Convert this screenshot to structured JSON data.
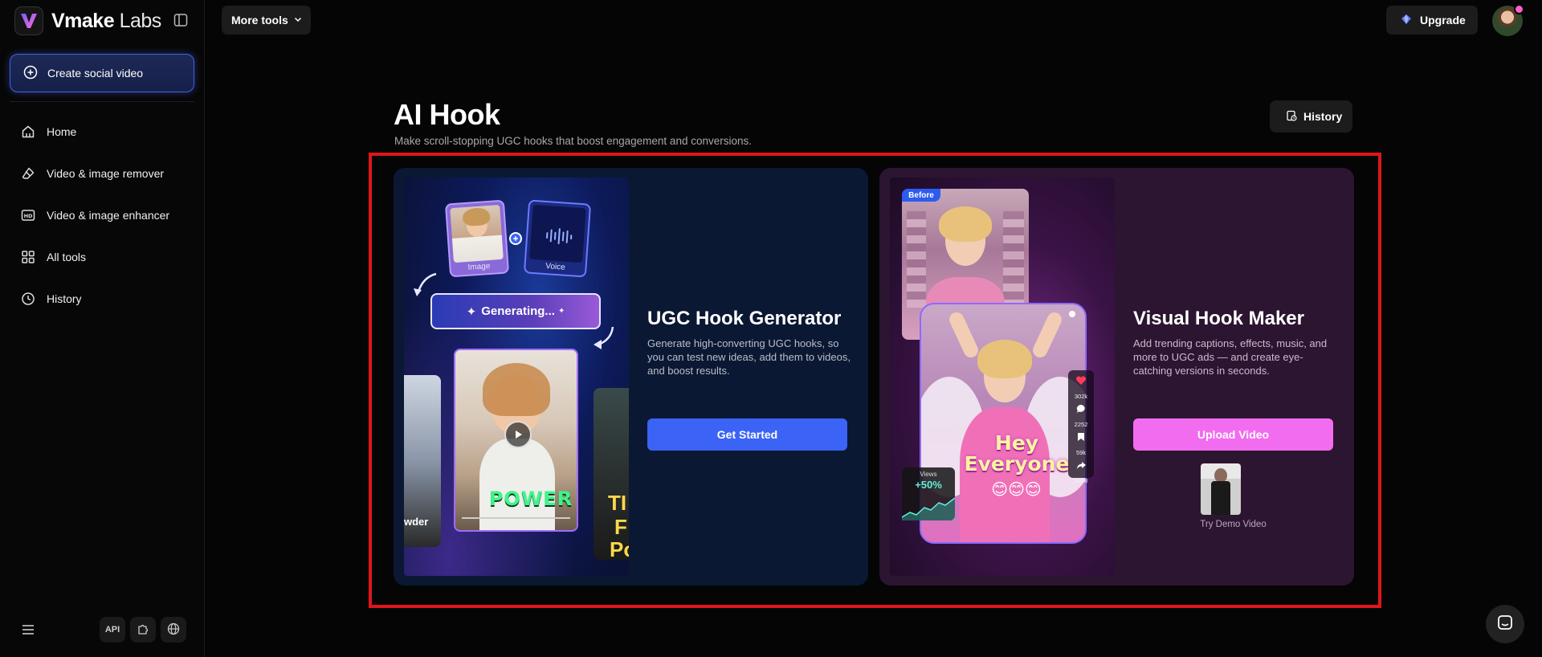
{
  "brand": {
    "name_bold": "Vmake",
    "name_light": " Labs",
    "icon": "vmake-logo"
  },
  "sidebar": {
    "create_label": "Create social video",
    "items": [
      {
        "label": "Home",
        "icon": "home-icon"
      },
      {
        "label": "Video & image remover",
        "icon": "eraser-icon"
      },
      {
        "label": "Video & image enhancer",
        "icon": "hd-icon"
      },
      {
        "label": "All tools",
        "icon": "grid-icon"
      },
      {
        "label": "History",
        "icon": "clock-icon"
      }
    ],
    "bottom": {
      "api_label": "API"
    }
  },
  "topbar": {
    "more_tools_label": "More tools",
    "upgrade_label": "Upgrade"
  },
  "page": {
    "title": "AI Hook",
    "subtitle": "Make scroll-stopping UGC hooks that boost engagement and conversions.",
    "history_label": "History"
  },
  "cards": {
    "ugc": {
      "title": "UGC Hook Generator",
      "description": "Generate high-converting UGC hooks, so you can test new ideas, add them to videos, and boost results.",
      "button_label": "Get Started",
      "media": {
        "image_label": "Image",
        "voice_label": "Voice",
        "generating_label": "Generating...",
        "power_text": "POWER",
        "left_tile_text": "wder",
        "right_tile_text_1": "TI",
        "right_tile_text_2": "F",
        "right_tile_text_3": "Po"
      }
    },
    "visual": {
      "title": "Visual Hook Maker",
      "description": "Add trending captions, effects, music, and more to UGC ads — and create eye-catching versions in seconds.",
      "button_label": "Upload Video",
      "demo_label": "Try Demo Video",
      "media": {
        "before_label": "Before",
        "hey_line1": "Hey",
        "hey_line2": "Everyone",
        "emojis": "😊😊😊",
        "likes": "302k",
        "comments": "2252",
        "saves": "59k",
        "shares": "5698",
        "views_label": "Views",
        "views_value": "+50%"
      }
    }
  },
  "colors": {
    "accent_blue": "#3b63f5",
    "accent_pink": "#f26cf0",
    "highlight_red": "#e0151b"
  }
}
